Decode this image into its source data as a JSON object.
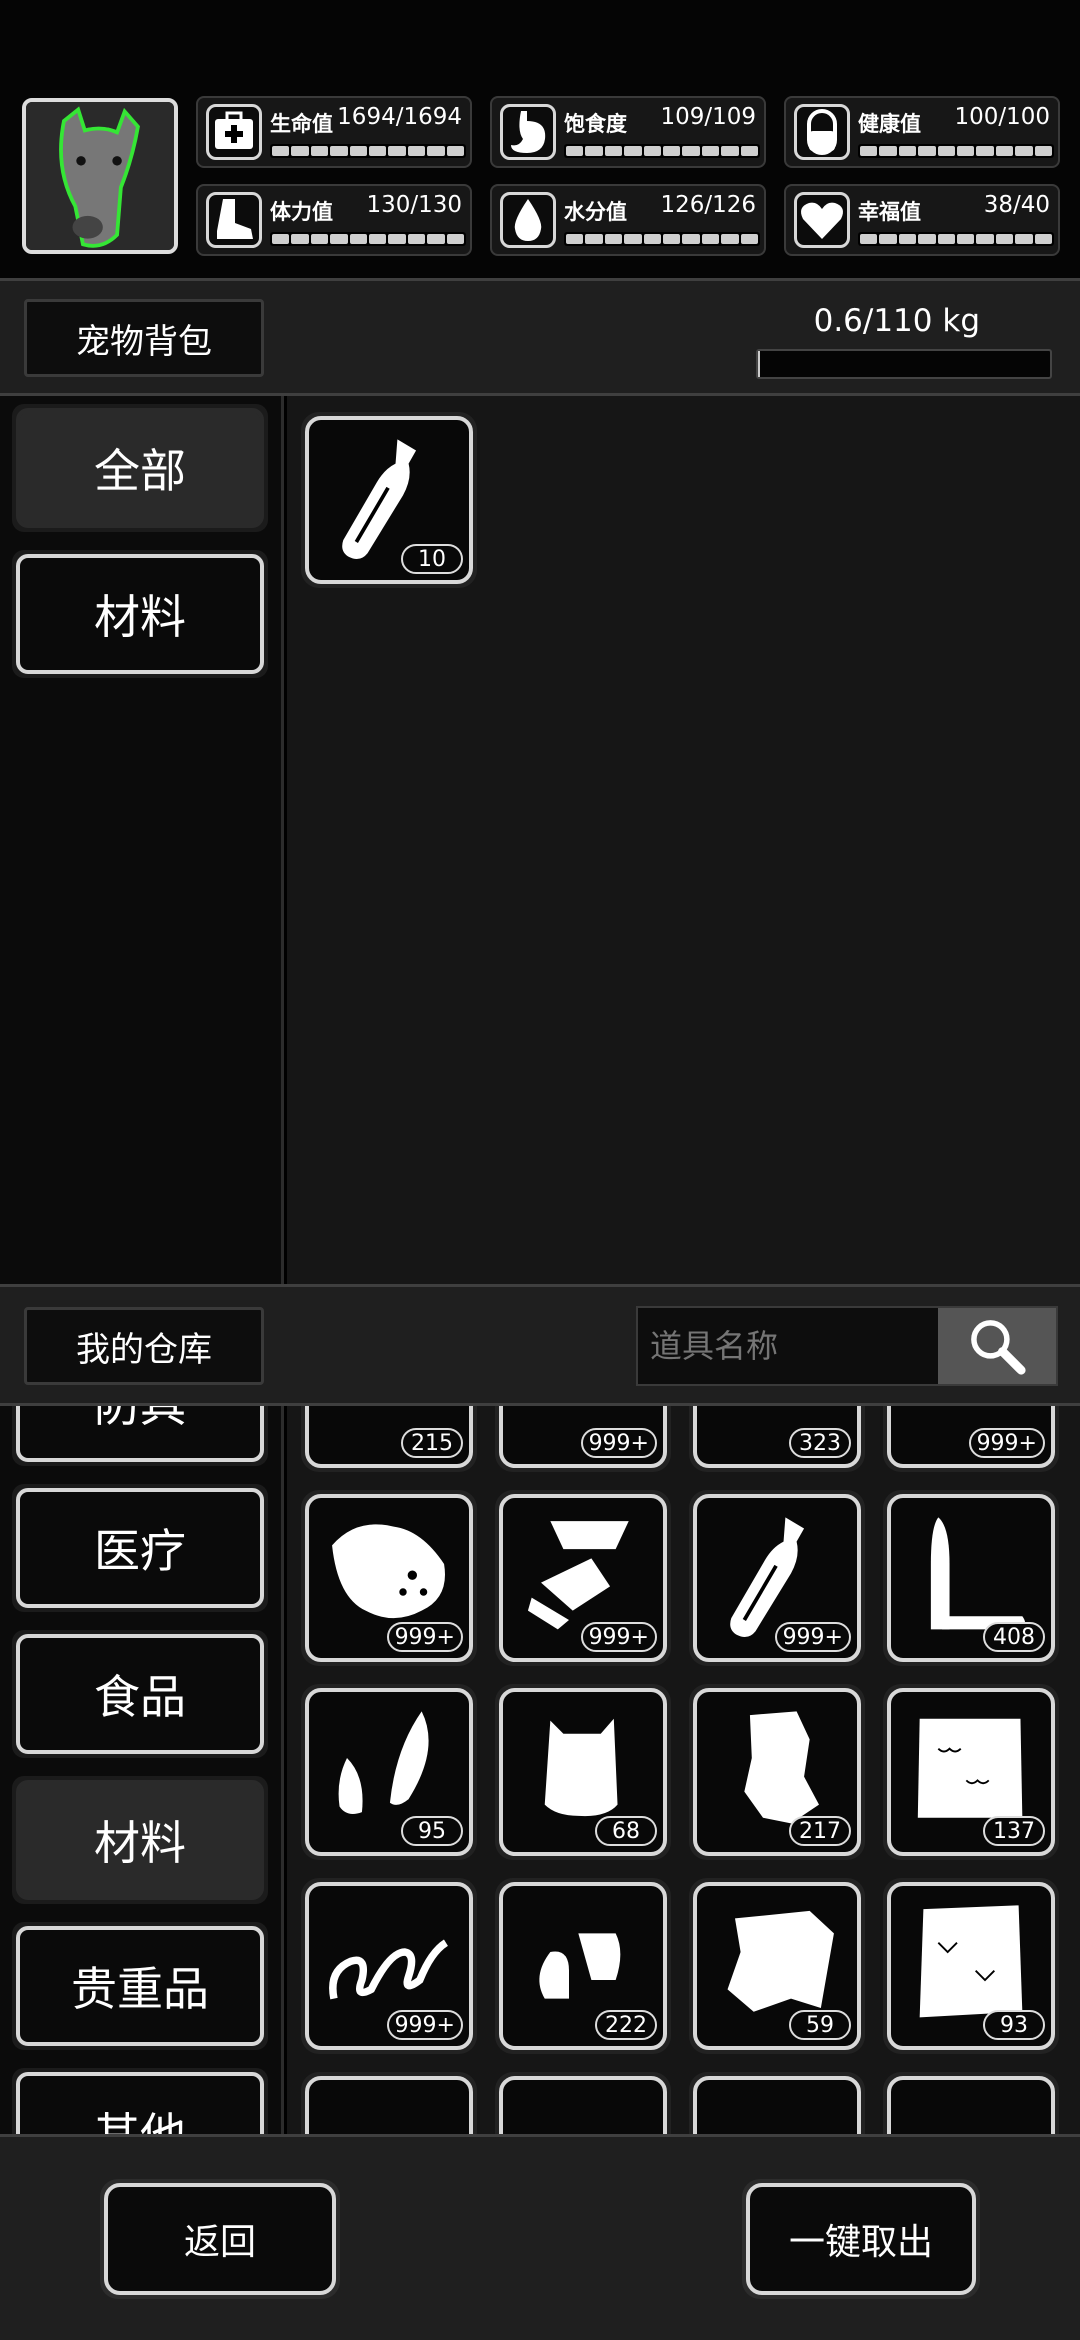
{
  "stats": [
    {
      "name": "生命值",
      "value": "1694/1694",
      "icon": "medkit-icon",
      "level": 1.0
    },
    {
      "name": "饱食度",
      "value": "109/109",
      "icon": "stomach-icon",
      "level": 1.0
    },
    {
      "name": "健康值",
      "value": "100/100",
      "icon": "pill-icon",
      "level": 1.0
    },
    {
      "name": "体力值",
      "value": "130/130",
      "icon": "boot-icon",
      "level": 1.0
    },
    {
      "name": "水分值",
      "value": "126/126",
      "icon": "water-drop-icon",
      "level": 1.0
    },
    {
      "name": "幸福值",
      "value": "38/40",
      "icon": "heart-icon",
      "level": 0.95
    }
  ],
  "pet_bag": {
    "title": "宠物背包",
    "weight": "0.6/110 kg",
    "weight_fraction": 0.005,
    "categories": [
      {
        "label": "全部",
        "active": true
      },
      {
        "label": "材料",
        "active": false
      }
    ],
    "items": [
      {
        "icon": "bottle-icon",
        "qty": "10"
      }
    ]
  },
  "warehouse": {
    "title": "我的仓库",
    "search_placeholder": "道具名称",
    "categories": [
      {
        "label": "防具",
        "active": false
      },
      {
        "label": "医疗",
        "active": false
      },
      {
        "label": "食品",
        "active": false
      },
      {
        "label": "材料",
        "active": true
      },
      {
        "label": "贵重品",
        "active": false
      },
      {
        "label": "其他",
        "active": false
      }
    ],
    "items": [
      {
        "icon": "battery-icon",
        "qty": "215"
      },
      {
        "icon": "stones-icon",
        "qty": "999+"
      },
      {
        "icon": "rolled-cloth-icon",
        "qty": "323"
      },
      {
        "icon": "knife-blade-icon",
        "qty": "999+"
      },
      {
        "icon": "meat-chunk-icon",
        "qty": "999+"
      },
      {
        "icon": "shards-icon",
        "qty": "999+"
      },
      {
        "icon": "bottle-icon",
        "qty": "999+"
      },
      {
        "icon": "bullet-icon",
        "qty": "408"
      },
      {
        "icon": "feather-icon",
        "qty": "95"
      },
      {
        "icon": "fur-pelt-icon",
        "qty": "68"
      },
      {
        "icon": "leather-scrap-icon",
        "qty": "217"
      },
      {
        "icon": "wool-pelt-icon",
        "qty": "137"
      },
      {
        "icon": "spring-icon",
        "qty": "999+"
      },
      {
        "icon": "bullet-tips-icon",
        "qty": "222"
      },
      {
        "icon": "hide-icon",
        "qty": "59"
      },
      {
        "icon": "fluffy-fur-icon",
        "qty": "93"
      }
    ]
  },
  "footer": {
    "back_label": "返回",
    "take_all_label": "一键取出"
  }
}
